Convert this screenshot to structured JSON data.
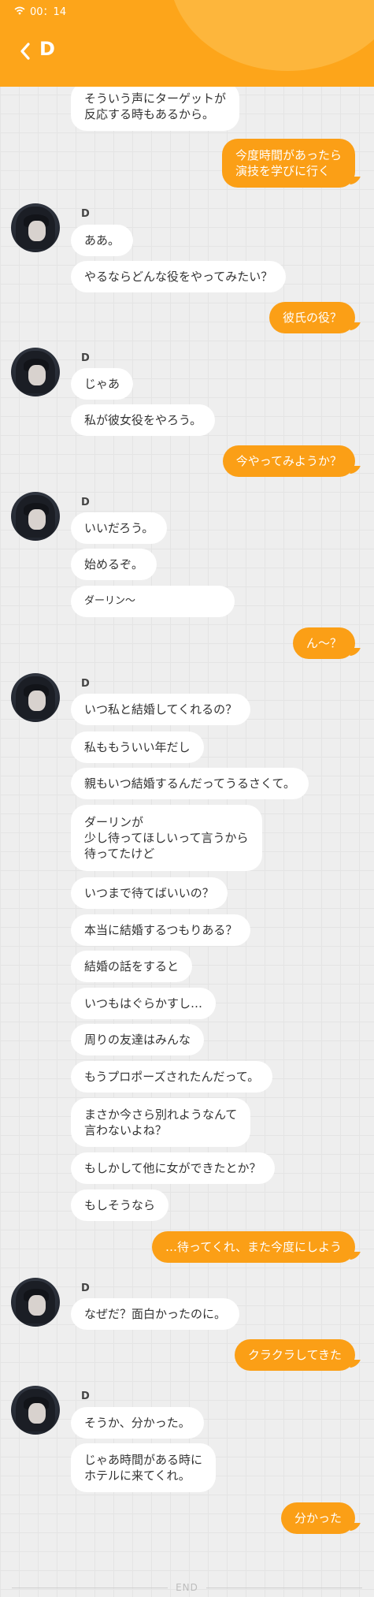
{
  "status_bar": {
    "time": "00：14",
    "wifi_icon": "wifi-icon"
  },
  "header": {
    "title": "D",
    "back_icon": "chevron-left-icon",
    "color": "#fda51a"
  },
  "chat": {
    "messages": [
      {
        "from": "D",
        "text": "そういう声にターゲットが\n反応する時もあるから。"
      },
      {
        "from": "me",
        "text": "今度時間があったら\n演技を学びに行く"
      },
      {
        "from": "D",
        "name": "D",
        "text": "ああ。"
      },
      {
        "from": "D",
        "text": "やるならどんな役をやってみたい？"
      },
      {
        "from": "me",
        "text": "彼氏の役？"
      },
      {
        "from": "D",
        "name": "D",
        "text": "じゃあ"
      },
      {
        "from": "D",
        "text": "私が彼女役をやろう。"
      },
      {
        "from": "me",
        "text": "今やってみようか？"
      },
      {
        "from": "D",
        "name": "D",
        "text": "いいだろう。"
      },
      {
        "from": "D",
        "text": "始めるぞ。"
      },
      {
        "from": "D",
        "text": "ダーリン～"
      },
      {
        "from": "me",
        "text": "ん～？"
      },
      {
        "from": "D",
        "name": "D",
        "text": "いつ私と結婚してくれるの？"
      },
      {
        "from": "D",
        "text": "私ももういい年だし"
      },
      {
        "from": "D",
        "text": "親もいつ結婚するんだってうるさくて。"
      },
      {
        "from": "D",
        "text": "ダーリンが\n少し待ってほしいって言うから\n待ってたけど"
      },
      {
        "from": "D",
        "text": "いつまで待てばいいの？"
      },
      {
        "from": "D",
        "text": "本当に結婚するつもりある？"
      },
      {
        "from": "D",
        "text": "結婚の話をすると"
      },
      {
        "from": "D",
        "text": "いつもはぐらかすし…"
      },
      {
        "from": "D",
        "text": "周りの友達はみんな"
      },
      {
        "from": "D",
        "text": "もうプロポーズされたんだって。"
      },
      {
        "from": "D",
        "text": "まさか今さら別れようなんて\n言わないよね？"
      },
      {
        "from": "D",
        "text": "もしかして他に女ができたとか？"
      },
      {
        "from": "D",
        "text": "もしそうなら"
      },
      {
        "from": "me",
        "text": "…待ってくれ、また今度にしよう"
      },
      {
        "from": "D",
        "name": "D",
        "text": "なぜだ？面白かったのに。"
      },
      {
        "from": "me",
        "text": "クラクラしてきた"
      },
      {
        "from": "D",
        "name": "D",
        "text": "そうか、分かった。"
      },
      {
        "from": "D",
        "text": "じゃあ時間がある時に\nホテルに来てくれ。"
      },
      {
        "from": "me",
        "text": "分かった"
      }
    ],
    "end_label": "END"
  },
  "colors": {
    "my_bubble": "#fb9f16",
    "their_bubble": "#ffffff",
    "background": "#eeeeee"
  }
}
